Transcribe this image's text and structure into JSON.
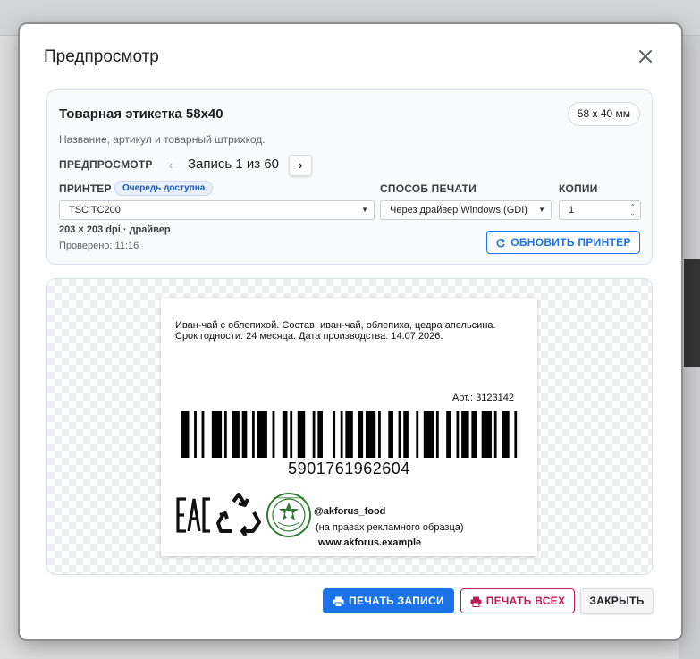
{
  "dialog": {
    "title": "Предпросмотр"
  },
  "template": {
    "title": "Товарная этикетка 58x40",
    "size_badge": "58 x 40 мм",
    "description": "Название, артикул и товарный штрихкод."
  },
  "preview_nav": {
    "label": "ПРЕДПРОСМОТР",
    "prev_icon": "chevron-left-icon",
    "record_text": "Запись 1 из 60",
    "next_icon": "chevron-right-icon"
  },
  "printer": {
    "label": "ПРИНТЕР",
    "queue_badge": "Очередь доступна",
    "selected": "TSC TC200",
    "details": "203 × 203 dpi · драйвер",
    "checked": "Проверено: 11:16",
    "refresh_button": "ОБНОВИТЬ ПРИНТЕР"
  },
  "print_method": {
    "label": "СПОСОБ ПЕЧАТИ",
    "selected": "Через драйвер Windows (GDI)"
  },
  "copies": {
    "label": "КОПИИ",
    "value": "1"
  },
  "label_preview": {
    "line1": "Иван-чай с облепихой. Состав: иван-чай, облепиха, цедра апельсина.",
    "line2": "Срок годности: 24 месяца. Дата производства: 14.07.2026.",
    "article": "Арт.: 3123142",
    "barcode_number": "5901761962604",
    "brand_handle": "@akforus_food",
    "brand_note": "(на правах рекламного образца)",
    "brand_site": "www.akforus.example"
  },
  "footer": {
    "print_record": "ПЕЧАТЬ ЗАПИСИ",
    "print_all": "ПЕЧАТЬ ВСЕХ",
    "close": "ЗАКРЫТЬ"
  },
  "colors": {
    "primary": "#1a73e8",
    "danger": "#c2185b"
  }
}
